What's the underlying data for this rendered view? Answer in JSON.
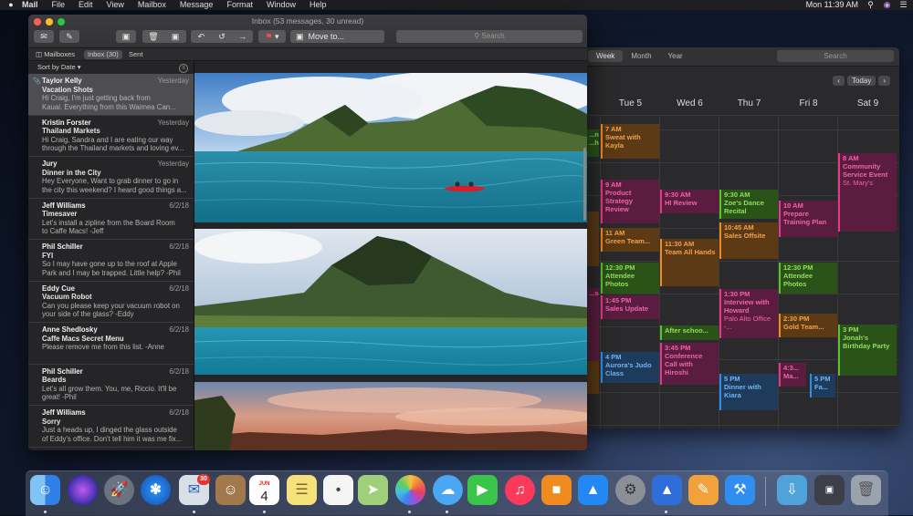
{
  "menubar": {
    "apple": "",
    "items": [
      "Mail",
      "File",
      "Edit",
      "View",
      "Mailbox",
      "Message",
      "Format",
      "Window",
      "Help"
    ],
    "clock": "Mon 11:39 AM"
  },
  "mail": {
    "window_title": "Inbox (53 messages, 30 unread)",
    "toolbar": {
      "move_to": "Move to...",
      "search_placeholder": "Search"
    },
    "favorites": {
      "mailboxes": "Mailboxes",
      "inbox": "Inbox (30)",
      "sent": "Sent"
    },
    "sort_label": "Sort by Date",
    "messages": [
      {
        "from": "Taylor Kelly",
        "date": "Yesterday",
        "subject": "Vacation Shots",
        "preview1": "Hi Craig, I'm just getting back from",
        "preview2": "Kauai. Everything from this Waimea Can..."
      },
      {
        "from": "Kristin Forster",
        "date": "Yesterday",
        "subject": "Thailand Markets",
        "preview1": "Hi Craig, Sandra and I are eating our way",
        "preview2": "through the Thailand markets and loving ev..."
      },
      {
        "from": "Jury",
        "date": "Yesterday",
        "subject": "Dinner in the City",
        "preview1": "Hey Everyone, Want to grab dinner to go in",
        "preview2": "the city this weekend? I heard good things a..."
      },
      {
        "from": "Jeff Williams",
        "date": "6/2/18",
        "subject": "Timesaver",
        "preview1": "Let's install a zipline from the Board Room",
        "preview2": "to Caffe Macs! -Jeff"
      },
      {
        "from": "Phil Schiller",
        "date": "6/2/18",
        "subject": "FYI",
        "preview1": "So I may have gone up to the roof at Apple",
        "preview2": "Park and I may be trapped. Little help? -Phil"
      },
      {
        "from": "Eddy Cue",
        "date": "6/2/18",
        "subject": "Vacuum Robot",
        "preview1": "Can you please keep your vacuum robot on",
        "preview2": "your side of the glass? -Eddy"
      },
      {
        "from": "Anne Shedlosky",
        "date": "6/2/18",
        "subject": "Caffe Macs Secret Menu",
        "preview1": "Please remove me from this list. -Anne",
        "preview2": ""
      },
      {
        "from": "Phil Schiller",
        "date": "6/2/18",
        "subject": "Beards",
        "preview1": "Let's all grow them. You, me, Riccio. It'll be",
        "preview2": "great! -Phil"
      },
      {
        "from": "Jeff Williams",
        "date": "6/2/18",
        "subject": "Sorry",
        "preview1": "Just a heads up, I dinged the glass outside",
        "preview2": "of Eddy's office. Don't tell him it was me fix..."
      }
    ]
  },
  "calendar": {
    "views": [
      "Week",
      "Month",
      "Year"
    ],
    "search_placeholder": "Search",
    "today_label": "Today",
    "days": [
      "Tue 5",
      "Wed 6",
      "Thu 7",
      "Fri 8",
      "Sat 9"
    ],
    "events": [
      {
        "day": 0,
        "time": "7 AM",
        "title": "Sweat with Kayla",
        "color": "orange"
      },
      {
        "day": 0,
        "time": "9 AM",
        "title": "Product Strategy Review",
        "color": "pink"
      },
      {
        "day": 0,
        "time": "11 AM",
        "title": "Green Team...",
        "color": "orange"
      },
      {
        "day": 0,
        "time": "12:30 PM",
        "title": "Attendee Photos",
        "color": "green"
      },
      {
        "day": 0,
        "time": "1:45 PM",
        "title": "Sales Update",
        "color": "pink"
      },
      {
        "day": 0,
        "time": "4 PM",
        "title": "Aurora's Judo Class",
        "color": "blue"
      },
      {
        "day": 1,
        "time": "9:30 AM",
        "title": "HI Review",
        "color": "pink"
      },
      {
        "day": 1,
        "time": "11:30 AM",
        "title": "Team All Hands",
        "color": "orange"
      },
      {
        "day": 1,
        "time": "",
        "title": "After schoo...",
        "color": "green"
      },
      {
        "day": 1,
        "time": "3:45 PM",
        "title": "Conference Call with Hiroshi",
        "color": "pink"
      },
      {
        "day": 2,
        "time": "9:30 AM",
        "title": "Zoe's Dance Recital",
        "color": "green"
      },
      {
        "day": 2,
        "time": "10:45 AM",
        "title": "Sales Offsite",
        "color": "orange"
      },
      {
        "day": 2,
        "time": "1:30 PM",
        "title": "Interview with Howard",
        "subtitle": "Palo Alto Office -...",
        "color": "pink"
      },
      {
        "day": 2,
        "time": "5 PM",
        "title": "Dinner with Kiara",
        "color": "blue"
      },
      {
        "day": 3,
        "time": "10 AM",
        "title": "Prepare Training Plan",
        "color": "pink"
      },
      {
        "day": 3,
        "time": "12:30 PM",
        "title": "Attendee Photos",
        "color": "green"
      },
      {
        "day": 3,
        "time": "2:30 PM",
        "title": "Gold Team...",
        "color": "orange"
      },
      {
        "day": 3,
        "time": "4:3...",
        "title": "Ma...",
        "color": "pink"
      },
      {
        "day": 3,
        "time": "5 PM",
        "title": "Fa...",
        "color": "blue"
      },
      {
        "day": 4,
        "time": "8 AM",
        "title": "Community Service Event",
        "subtitle": "St. Mary's",
        "color": "pink"
      },
      {
        "day": 4,
        "time": "3 PM",
        "title": "Jonah's Birthday Party",
        "color": "green"
      }
    ],
    "left_partial": [
      "...n",
      "...h",
      "...se"
    ]
  },
  "dock": {
    "calendar_month": "JUN",
    "calendar_day": "4",
    "mail_badge": "30"
  }
}
